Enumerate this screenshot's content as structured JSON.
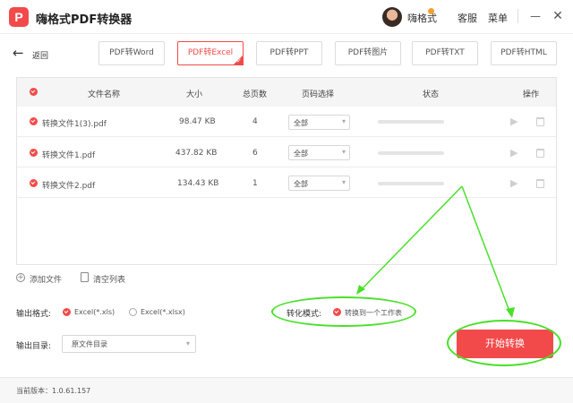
{
  "app": {
    "logo_letter": "P",
    "title": "嗨格式PDF转换器",
    "user_name": "嗨格式",
    "service_label": "客服",
    "menu_label": "菜单",
    "minimize_symbol": "—",
    "close_symbol": "✕"
  },
  "toolbar": {
    "back_symbol": "←",
    "back_label": "返回",
    "tabs": [
      {
        "label": "PDF转Word",
        "active": false
      },
      {
        "label": "PDF转Excel",
        "active": true
      },
      {
        "label": "PDF转PPT",
        "active": false
      },
      {
        "label": "PDF转图片",
        "active": false
      },
      {
        "label": "PDF转TXT",
        "active": false
      },
      {
        "label": "PDF转HTML",
        "active": false
      }
    ],
    "active_check": "✓"
  },
  "table": {
    "headers": {
      "name": "文件名称",
      "size": "大小",
      "pages": "总页数",
      "range": "页码选择",
      "status": "状态",
      "actions": "操作"
    },
    "rows": [
      {
        "name": "转换文件1(3).pdf",
        "size": "98.47 KB",
        "pages": "4",
        "range": "全部"
      },
      {
        "name": "转换文件1.pdf",
        "size": "437.82 KB",
        "pages": "6",
        "range": "全部"
      },
      {
        "name": "转换文件2.pdf",
        "size": "134.43 KB",
        "pages": "1",
        "range": "全部"
      }
    ],
    "dropdown_symbol": "▾",
    "play_symbol": "▶"
  },
  "file_actions": {
    "add_symbol": "+",
    "add_label": "添加文件",
    "clear_label": "清空列表"
  },
  "output_format": {
    "label": "输出格式:",
    "options": [
      {
        "label": "Excel(*.xls)",
        "selected": true
      },
      {
        "label": "Excel(*.xlsx)",
        "selected": false
      }
    ]
  },
  "conversion_mode": {
    "label": "转化模式:",
    "option": "转换到一个工作表",
    "selected": true
  },
  "output_dir": {
    "label": "输出目录:",
    "value": "原文件目录"
  },
  "start_button": {
    "label": "开始转换"
  },
  "status_bar": {
    "version": "当前版本：1.0.61.157"
  },
  "colors": {
    "accent": "#f24a4a",
    "annotation": "#49e02a"
  }
}
